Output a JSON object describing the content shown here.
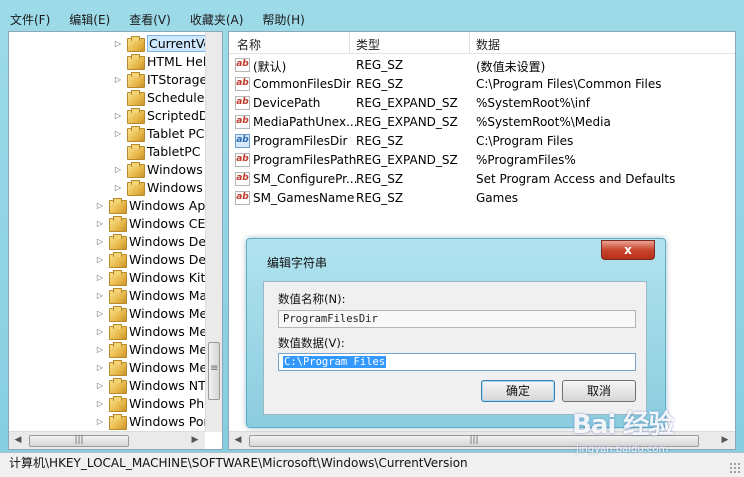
{
  "menu": [
    "文件(F)",
    "编辑(E)",
    "查看(V)",
    "收藏夹(A)",
    "帮助(H)"
  ],
  "tree": {
    "nested": [
      {
        "label": "CurrentVe",
        "selected": true
      },
      {
        "label": "HTML Hel",
        "expandable": false
      },
      {
        "label": "ITStorage"
      },
      {
        "label": "Scheduled",
        "expandable": false
      },
      {
        "label": "ScriptedD"
      },
      {
        "label": "Tablet PC"
      },
      {
        "label": "TabletPC",
        "expandable": false
      },
      {
        "label": "Windows"
      },
      {
        "label": "Windows"
      }
    ],
    "top": [
      "Windows App",
      "Windows CE",
      "Windows Def",
      "Windows Des",
      "Windows Kits",
      "Windows Ma",
      "Windows Me",
      "Windows Me",
      "Windows Me",
      "Windows Me",
      "Windows NT",
      "Windows Pho",
      "Windows Por"
    ]
  },
  "list": {
    "headers": {
      "name": "名称",
      "type": "类型",
      "data": "数据"
    },
    "rows": [
      {
        "name": "(默认)",
        "type": "REG_SZ",
        "data": "(数值未设置)",
        "icon": "string-value-icon"
      },
      {
        "name": "CommonFilesDir",
        "type": "REG_SZ",
        "data": "C:\\Program Files\\Common Files",
        "icon": "string-value-icon"
      },
      {
        "name": "DevicePath",
        "type": "REG_EXPAND_SZ",
        "data": "%SystemRoot%\\inf",
        "icon": "string-value-icon"
      },
      {
        "name": "MediaPathUnex...",
        "type": "REG_EXPAND_SZ",
        "data": "%SystemRoot%\\Media",
        "icon": "string-value-icon"
      },
      {
        "name": "ProgramFilesDir",
        "type": "REG_SZ",
        "data": "C:\\Program Files",
        "icon": "string-value-icon-selected"
      },
      {
        "name": "ProgramFilesPath",
        "type": "REG_EXPAND_SZ",
        "data": "%ProgramFiles%",
        "icon": "string-value-icon"
      },
      {
        "name": "SM_ConfigurePr...",
        "type": "REG_SZ",
        "data": "Set Program Access and Defaults",
        "icon": "string-value-icon"
      },
      {
        "name": "SM_GamesName",
        "type": "REG_SZ",
        "data": "Games",
        "icon": "string-value-icon"
      }
    ]
  },
  "dialog": {
    "title": "编辑字符串",
    "close": "x",
    "name_label": "数值名称(N):",
    "name_value": "ProgramFilesDir",
    "data_label": "数值数据(V):",
    "data_value": "C:\\Program Files",
    "ok": "确定",
    "cancel": "取消"
  },
  "status": "计算机\\HKEY_LOCAL_MACHINE\\SOFTWARE\\Microsoft\\Windows\\CurrentVersion",
  "watermark": {
    "logo": "Bai 经验",
    "sub": "jingyan.baidu.com"
  },
  "colors": {
    "selection": "#3399ff",
    "close_button": "#c9452c",
    "background": "#84cde0"
  }
}
